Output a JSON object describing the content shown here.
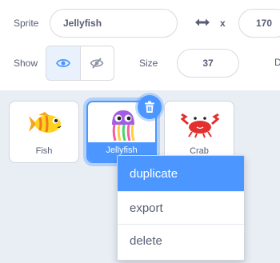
{
  "info": {
    "sprite_label": "Sprite",
    "sprite_name": "Jellyfish",
    "x_label": "x",
    "x_value": "170",
    "show_label": "Show",
    "size_label": "Size",
    "size_value": "37",
    "cut_label": "D"
  },
  "sprites": [
    {
      "name": "Fish"
    },
    {
      "name": "Jellyfish"
    },
    {
      "name": "Crab"
    }
  ],
  "context_menu": {
    "items": [
      "duplicate",
      "export",
      "delete"
    ]
  },
  "colors": {
    "accent": "#4c97ff",
    "text": "#575e75",
    "sprite_pane": "#e9eef5"
  }
}
